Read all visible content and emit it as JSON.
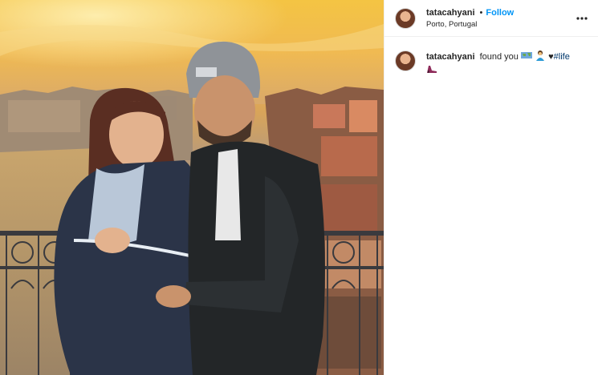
{
  "post": {
    "photo": {
      "alt": ""
    },
    "header": {
      "username": "tatacahyani",
      "separator": "•",
      "follow_label": "Follow",
      "location": "Porto, Portugal",
      "more_icon": "more-horizontal-icon"
    },
    "caption": {
      "username": "tatacahyani",
      "text": "found you",
      "heart": "♥",
      "hashtag": "#life",
      "emojis": [
        "world-map-icon",
        "woman-dancing-icon",
        "black-heart-icon",
        "high-heel-icon"
      ]
    }
  },
  "colors": {
    "follow": "#0095f6",
    "text": "#262626",
    "hashtag": "#00376b",
    "divider": "#efefef"
  }
}
